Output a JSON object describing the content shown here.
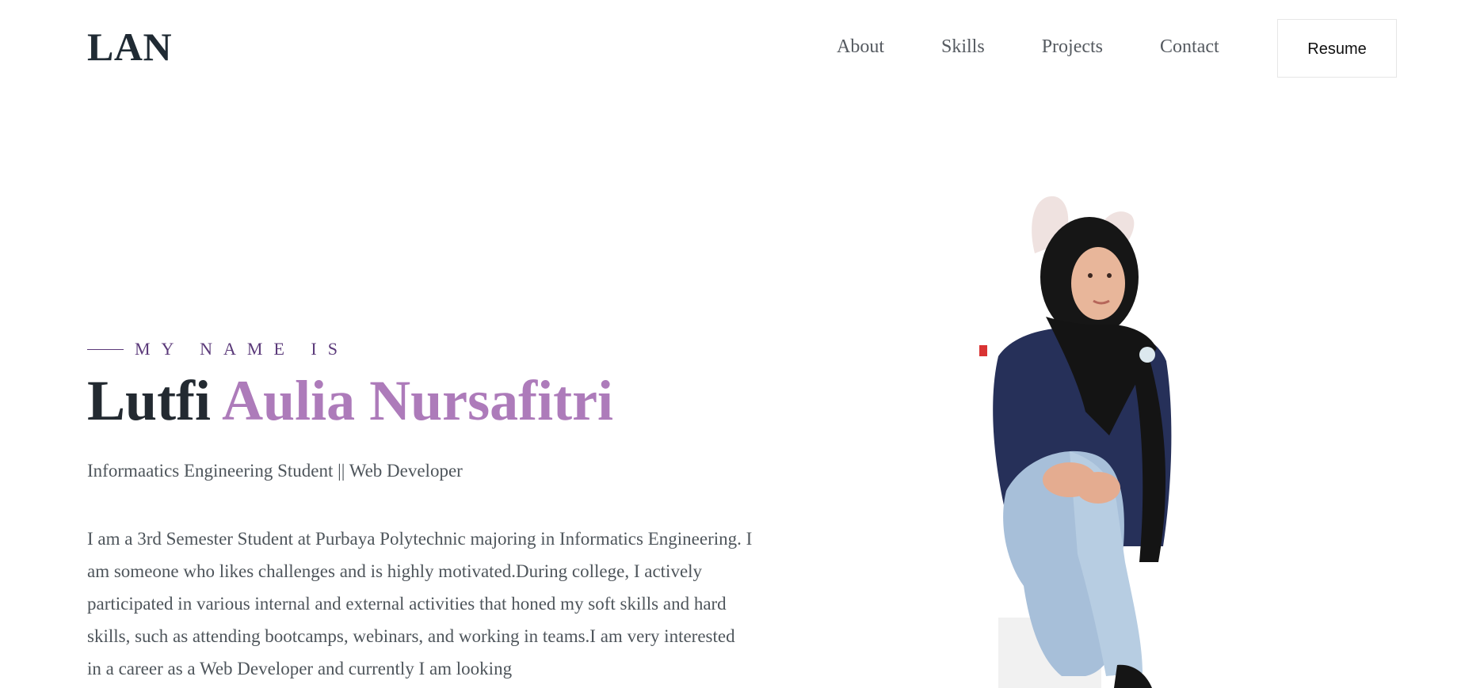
{
  "header": {
    "logo": "LAN",
    "nav": [
      {
        "label": "About"
      },
      {
        "label": "Skills"
      },
      {
        "label": "Projects"
      },
      {
        "label": "Contact"
      }
    ],
    "resume_label": "Resume"
  },
  "hero": {
    "eyebrow": "MY NAME IS",
    "first_name": "Lutfi",
    "last_name": "Aulia Nursafitri",
    "subtitle": "Informaatics Engineering Student || Web Developer",
    "bio": "I am a 3rd Semester Student at Purbaya Polytechnic majoring in Informatics Engineering. I am someone who likes challenges and is highly motivated.During college, I actively participated in various internal and external activities that honed my soft skills and hard skills, such as attending bootcamps, webinars, and working in teams.I am very interested in a career as a Web Developer and currently I am looking"
  },
  "colors": {
    "accent": "#ad7bba",
    "eyebrow": "#5b3a7a",
    "heading": "#232a31",
    "body": "#4e555b"
  }
}
